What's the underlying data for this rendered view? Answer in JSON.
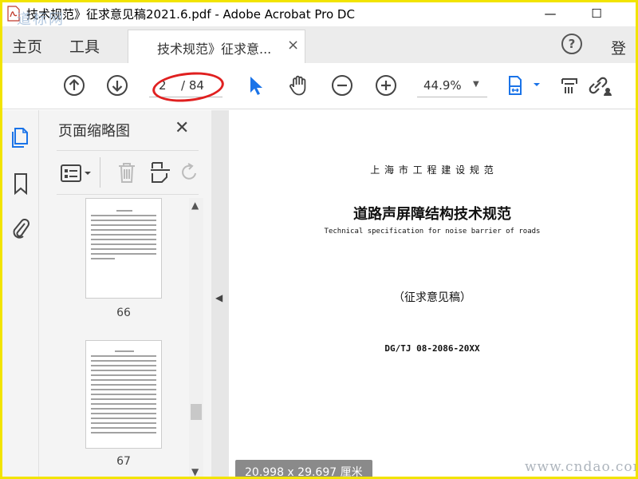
{
  "window": {
    "title": "技术规范》征求意见稿2021.6.pdf - Adobe Acrobat Pro DC",
    "watermark": "道标网",
    "minimize": "—",
    "maximize": "☐"
  },
  "menubar": {
    "home": "主页",
    "tools": "工具",
    "doc_tab": "技术规范》征求意...",
    "doc_tab_close": "×",
    "help": "?",
    "login": "登录"
  },
  "toolbar": {
    "page_current": "2",
    "page_total": "/ 84",
    "zoom": "44.9%",
    "zoom_caret": "▼"
  },
  "thumbnail_panel": {
    "title": "页面缩略图",
    "close": "✕",
    "thumbs": [
      {
        "label": "66"
      },
      {
        "label": "67"
      }
    ]
  },
  "document": {
    "issuer": "上 海 市 工 程 建 设 规 范",
    "title_cn": "道路声屏障结构技术规范",
    "title_en": "Technical specification for noise barrier of roads",
    "status": "（征求意见稿）",
    "code": "DG/TJ 08-2086-20XX"
  },
  "status": {
    "page_size": "20.998 x 29.697 厘米",
    "watermark": "www.cndao.com"
  },
  "colors": {
    "accent_blue": "#1a73e8",
    "annotation_red": "#e02020",
    "frame_yellow": "#f2e400"
  },
  "icons": {
    "prev_page": "arrow-up-circle-icon",
    "next_page": "arrow-down-circle-icon",
    "select": "cursor-arrow-icon",
    "hand": "hand-icon",
    "zoom_out": "minus-circle-icon",
    "zoom_in": "plus-circle-icon",
    "fit": "fit-page-icon",
    "scan": "scan-icon",
    "link": "link-icon",
    "share": "share-user-icon"
  }
}
